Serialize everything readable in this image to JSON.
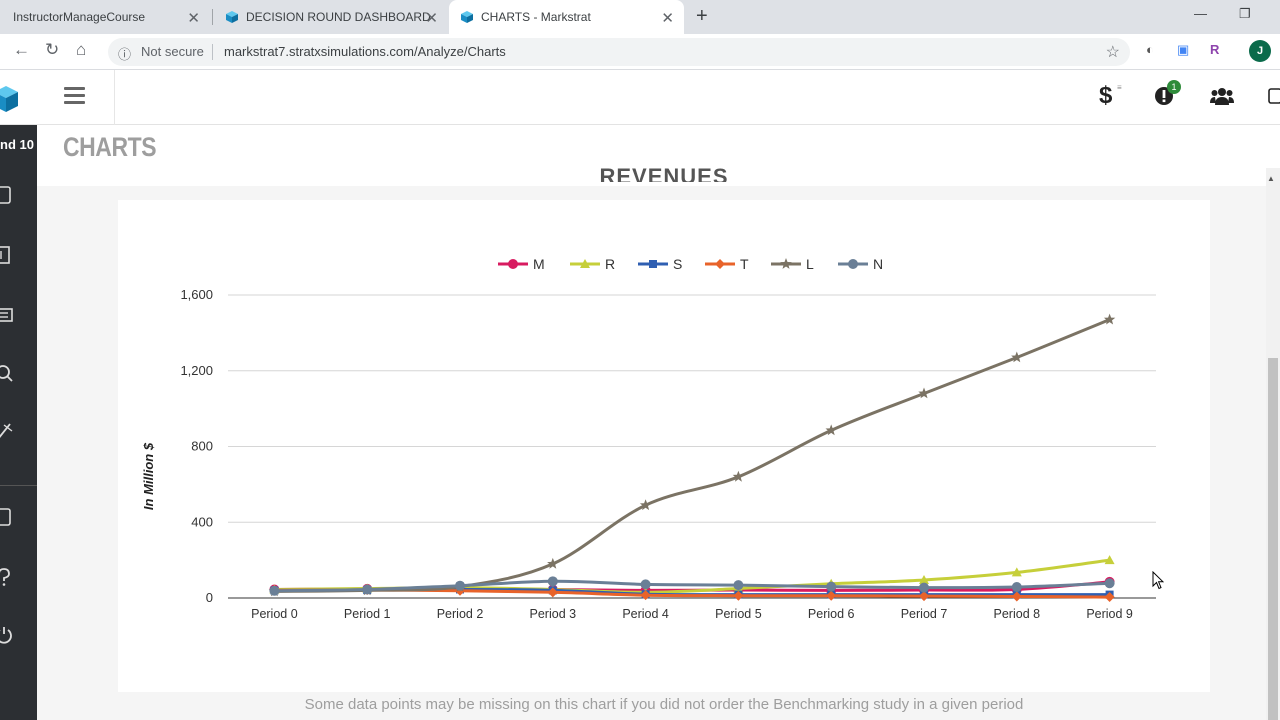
{
  "browser": {
    "tabs": [
      {
        "title": "InstructorManageCourse",
        "active": false
      },
      {
        "title": "DECISION ROUND DASHBOARD",
        "active": false
      },
      {
        "title": "CHARTS - Markstrat",
        "active": true
      }
    ],
    "security_label": "Not secure",
    "url": "markstrat7.stratxsimulations.com/Analyze/Charts",
    "profile_initial": "J",
    "extension_r_label": "R"
  },
  "app": {
    "round_label": "nd 10",
    "page_title": "CHARTS",
    "chart_heading": "REVENUES",
    "alerts_count": "1",
    "footnote": "Some data points may be missing on this chart if you did not order the Benchmarking study in a given period"
  },
  "colors": {
    "M": "#d81b60",
    "R": "#c6cf3a",
    "S": "#2f5fb2",
    "T": "#e8632a",
    "L": "#7b7364",
    "N": "#6a7f96"
  },
  "chart_data": {
    "type": "line",
    "title": "REVENUES",
    "ylabel": "In Million $",
    "xlabel": "",
    "categories": [
      "Period 0",
      "Period 1",
      "Period 2",
      "Period 3",
      "Period 4",
      "Period 5",
      "Period 6",
      "Period 7",
      "Period 8",
      "Period 9"
    ],
    "ylim": [
      0,
      1600
    ],
    "yticks": [
      0,
      400,
      800,
      1200,
      1600
    ],
    "ytick_labels": [
      "0",
      "400",
      "800",
      "1,200",
      "1,600"
    ],
    "grid": true,
    "legend_position": "top-center",
    "series": [
      {
        "name": "M",
        "marker": "circle",
        "values": [
          45,
          48,
          52,
          45,
          40,
          42,
          40,
          42,
          45,
          85
        ]
      },
      {
        "name": "R",
        "marker": "triangle",
        "values": [
          45,
          50,
          55,
          45,
          30,
          50,
          75,
          95,
          135,
          200
        ]
      },
      {
        "name": "S",
        "marker": "square",
        "values": [
          40,
          42,
          45,
          40,
          20,
          18,
          18,
          18,
          18,
          18
        ]
      },
      {
        "name": "T",
        "marker": "diamond",
        "values": [
          40,
          42,
          38,
          30,
          15,
          12,
          12,
          10,
          8,
          5
        ]
      },
      {
        "name": "L",
        "marker": "star",
        "values": [
          35,
          40,
          60,
          180,
          490,
          640,
          885,
          1080,
          1270,
          1470
        ]
      },
      {
        "name": "N",
        "marker": "circle",
        "values": [
          38,
          45,
          65,
          88,
          72,
          68,
          60,
          55,
          58,
          78
        ]
      }
    ]
  }
}
